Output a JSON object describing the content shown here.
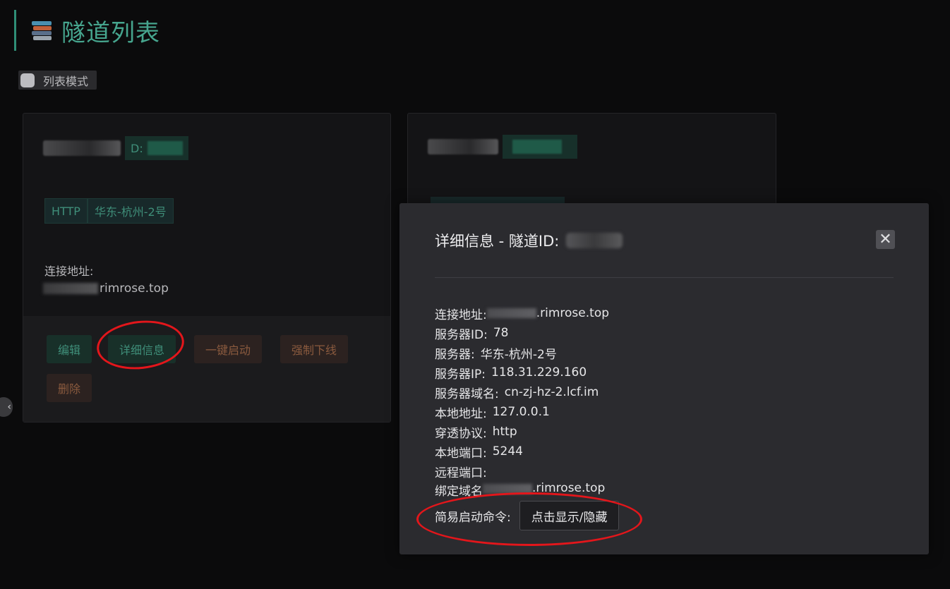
{
  "page": {
    "title": "隧道列表",
    "list_mode_label": "列表模式"
  },
  "cards": [
    {
      "id_prefix": "D:",
      "protocol_tag": "HTTP",
      "server_tag": "华东-杭州-2号",
      "conn_label": "连接地址:",
      "conn_domain": "rimrose.top",
      "buttons": {
        "edit": "编辑",
        "details": "详细信息",
        "start": "一键启动",
        "offline": "强制下线",
        "delete": "删除"
      }
    }
  ],
  "side_button_glyph": "‹",
  "modal": {
    "title": "详细信息 - 隧道ID:",
    "close_glyph": "✕",
    "rows": [
      {
        "label": "连接地址:",
        "value": ".rimrose.top",
        "masked": true
      },
      {
        "label": "服务器ID:",
        "value": "78"
      },
      {
        "label": "服务器:",
        "value": "华东-杭州-2号"
      },
      {
        "label": "服务器IP:",
        "value": "118.31.229.160"
      },
      {
        "label": "服务器域名:",
        "value": "cn-zj-hz-2.lcf.im"
      },
      {
        "label": "本地地址:",
        "value": "127.0.0.1"
      },
      {
        "label": "穿透协议:",
        "value": "http"
      },
      {
        "label": "本地端口:",
        "value": "5244"
      },
      {
        "label": "远程端口:",
        "value": ""
      },
      {
        "label": "绑定域名",
        "value": ".rimrose.top",
        "masked": true
      }
    ],
    "cmd_label": "简易启动命令:",
    "cmd_button": "点击显示/隐藏"
  },
  "colors": {
    "accent": "#46a58e",
    "background": "#0b0b0c",
    "modal_bg": "#2b2b2f",
    "annotation": "#e3161b"
  },
  "icons": {
    "title_icon": "books-icon",
    "close_icon": "close-icon"
  }
}
